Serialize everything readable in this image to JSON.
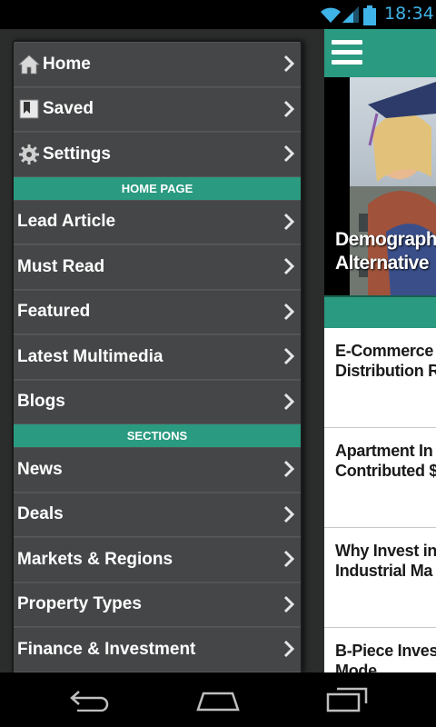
{
  "status": {
    "time": "18:34",
    "accent": "#3fb4e8"
  },
  "drawer": {
    "top_items": [
      {
        "label": "Home",
        "icon": "home-icon"
      },
      {
        "label": "Saved",
        "icon": "bookmark-icon"
      },
      {
        "label": "Settings",
        "icon": "gear-icon"
      }
    ],
    "home_page_header": "HOME PAGE",
    "home_page_items": [
      {
        "label": "Lead Article"
      },
      {
        "label": "Must Read"
      },
      {
        "label": "Featured"
      },
      {
        "label": "Latest Multimedia"
      },
      {
        "label": "Blogs"
      }
    ],
    "sections_header": "SECTIONS",
    "sections_items": [
      {
        "label": "News"
      },
      {
        "label": "Deals"
      },
      {
        "label": "Markets & Regions"
      },
      {
        "label": "Property Types"
      },
      {
        "label": "Finance & Investment"
      }
    ],
    "accent": "#2a9a80"
  },
  "background_app": {
    "hero_caption_line1": "Demograph",
    "hero_caption_line2": "Alternative",
    "stories": [
      {
        "line1": "E-Commerce",
        "line2": "Distribution R"
      },
      {
        "line1": "Apartment In",
        "line2": "Contributed $"
      },
      {
        "line1": "Why Invest in",
        "line2": "Industrial Ma"
      },
      {
        "line1": "B-Piece Inves",
        "line2": "Mode"
      }
    ]
  },
  "nav": {
    "buttons": [
      "back-icon",
      "home-icon",
      "recent-apps-icon"
    ]
  }
}
